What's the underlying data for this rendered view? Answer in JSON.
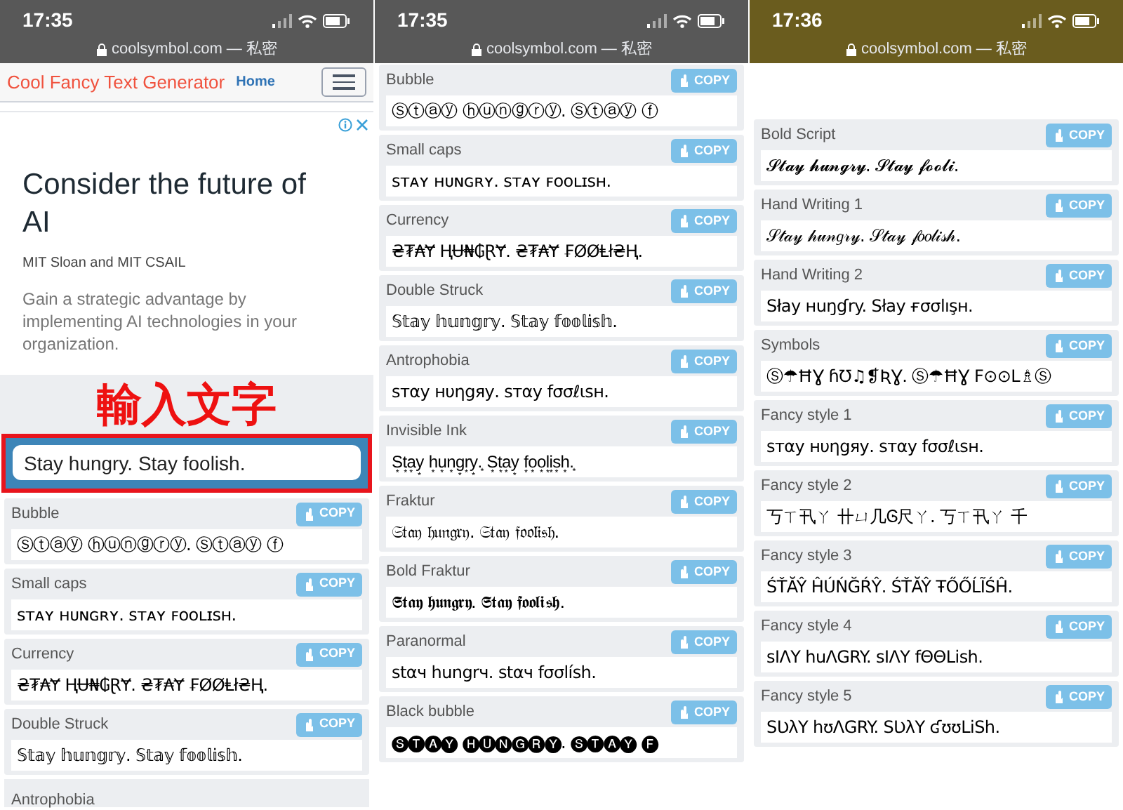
{
  "panels": [
    {
      "status_bar": {
        "time": "17:35",
        "url": "coolsymbol.com — 私密",
        "color": "#585858"
      },
      "header": {
        "title": "Cool Fancy Text Generator",
        "link": "Home"
      },
      "ad": {
        "heading": "Consider the future of AI",
        "sponsor": "MIT Sloan and MIT CSAIL",
        "body": "Gain a strategic advantage by implementing AI technologies in your organization."
      },
      "annotation": {
        "text": "輸入文字"
      },
      "input": {
        "value": "Stay hungry. Stay foolish."
      },
      "styles": [
        {
          "name": "Bubble",
          "copy": "COPY",
          "text": "Ⓢⓣⓐⓨ ⓗⓤⓝⓖⓡⓨ. Ⓢⓣⓐⓨ ⓕ"
        },
        {
          "name": "Small caps",
          "copy": "COPY",
          "text": "ꜱᴛᴀʏ ʜᴜɴɢʀʏ. ꜱᴛᴀʏ ꜰᴏᴏʟɪꜱʜ."
        },
        {
          "name": "Currency",
          "copy": "COPY",
          "text": "₴₮₳Ɏ ⱧɄ₦₲ⱤɎ. ₴₮₳Ɏ ₣ØØⱠł₴Ⱨ."
        },
        {
          "name": "Double Struck",
          "copy": "COPY",
          "text": "𝕊𝕥𝕒𝕪 𝕙𝕦𝕟𝕘𝕣𝕪. 𝕊𝕥𝕒𝕪 𝕗𝕠𝕠𝕝𝕚𝕤𝕙."
        }
      ],
      "cut_label": "Antrophobia"
    },
    {
      "status_bar": {
        "time": "17:35",
        "url": "coolsymbol.com — 私密",
        "color": "#585858"
      },
      "styles": [
        {
          "name": "Bubble",
          "copy": "COPY",
          "text": "Ⓢⓣⓐⓨ ⓗⓤⓝⓖⓡⓨ. Ⓢⓣⓐⓨ ⓕ"
        },
        {
          "name": "Small caps",
          "copy": "COPY",
          "text": "ꜱᴛᴀʏ ʜᴜɴɢʀʏ. ꜱᴛᴀʏ ꜰᴏᴏʟɪꜱʜ."
        },
        {
          "name": "Currency",
          "copy": "COPY",
          "text": "₴₮₳Ɏ ⱧɄ₦₲ⱤɎ. ₴₮₳Ɏ ₣ØØⱠł₴Ⱨ."
        },
        {
          "name": "Double Struck",
          "copy": "COPY",
          "text": "𝕊𝕥𝕒𝕪 𝕙𝕦𝕟𝕘𝕣𝕪. 𝕊𝕥𝕒𝕪 𝕗𝕠𝕠𝕝𝕚𝕤𝕙."
        },
        {
          "name": "Antrophobia",
          "copy": "COPY",
          "text": "ѕтαу нυηgяу. ѕтαу fσσℓιѕн."
        },
        {
          "name": "Invisible Ink",
          "copy": "COPY",
          "text": "S͙t͙a͙y͙ h͙u͙n͙g͙r͙y͙.͙ S͙t͙a͙y͙ f͙o͙o͙l͙i͙s͙h͙.͙"
        },
        {
          "name": "Fraktur",
          "copy": "COPY",
          "text": "𝔖𝔱𝔞𝔶 𝔥𝔲𝔫𝔤𝔯𝔶. 𝔖𝔱𝔞𝔶 𝔣𝔬𝔬𝔩𝔦𝔰𝔥."
        },
        {
          "name": "Bold Fraktur",
          "copy": "COPY",
          "text": "𝕾𝖙𝖆𝖞 𝖍𝖚𝖓𝖌𝖗𝖞. 𝕾𝖙𝖆𝖞 𝖋𝖔𝖔𝖑𝖎𝖘𝖍."
        },
        {
          "name": "Paranormal",
          "copy": "COPY",
          "text": "stαч hungrч. stαч fσσlísh."
        },
        {
          "name": "Black bubble",
          "copy": "COPY",
          "text": "🅢🅣🅐🅨 🅗🅤🅝🅖🅡🅨. 🅢🅣🅐🅨 🅕"
        }
      ]
    },
    {
      "status_bar": {
        "time": "17:36",
        "url": "coolsymbol.com — 私密",
        "color": "#6a5c1e"
      },
      "styles": [
        {
          "name": "Bold Script",
          "copy": "COPY",
          "text": "𝓢𝓽𝓪𝔂 𝓱𝓾𝓷𝓰𝓻𝔂. 𝓢𝓽𝓪𝔂 𝓯𝓸𝓸𝓵𝓲."
        },
        {
          "name": "Hand Writing 1",
          "copy": "COPY",
          "text": "𝒮𝓉𝒶𝓎 𝒽𝓊𝓃𝑔𝓇𝓎. 𝒮𝓉𝒶𝓎 𝒻𝑜𝑜𝓁𝒾𝓈𝒽."
        },
        {
          "name": "Hand Writing 2",
          "copy": "COPY",
          "text": "Słay ʜuŋɠry. Słay ғσσlışʜ."
        },
        {
          "name": "Symbols",
          "copy": "COPY",
          "text": "Ⓢ☂ĦƔ ɦƱ♫❡ƦƔ. Ⓢ☂ĦƔ F⊙⊙L♗Ⓢ"
        },
        {
          "name": "Fancy style 1",
          "copy": "COPY",
          "text": "ѕтαу нυηgяу. ѕтαу fσσℓιѕн."
        },
        {
          "name": "Fancy style 2",
          "copy": "COPY",
          "text": "丂ㄒ卂ㄚ 卄ㄩ几Ꮆ尺ㄚ. 丂ㄒ卂ㄚ 千"
        },
        {
          "name": "Fancy style 3",
          "copy": "COPY",
          "text": "ŚŤĂŶ ĤÚŃĞŔŶ. ŚŤĂŶ ŦŐŐĹĨŚĤ."
        },
        {
          "name": "Fancy style 4",
          "copy": "COPY",
          "text": "sIΛY huΛGRY. sIΛY fΘΘLish."
        },
        {
          "name": "Fancy style 5",
          "copy": "COPY",
          "text": "SƲλY hʊΛGRY. SƲλY ʛʊʊLiSh."
        }
      ]
    }
  ]
}
